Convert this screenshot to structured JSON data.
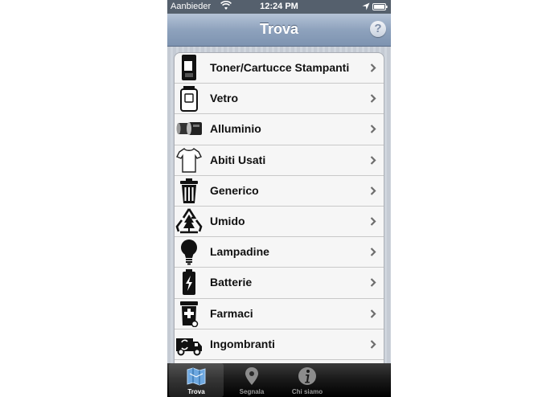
{
  "status_bar": {
    "carrier": "Aanbieder",
    "time": "12:24 PM"
  },
  "nav": {
    "title": "Trova",
    "help_glyph": "?"
  },
  "list": {
    "items": [
      {
        "label": "Toner/Cartucce Stampanti",
        "icon": "printer-cartridge-icon"
      },
      {
        "label": "Vetro",
        "icon": "glass-jar-icon"
      },
      {
        "label": "Alluminio",
        "icon": "aluminium-cans-icon"
      },
      {
        "label": "Abiti Usati",
        "icon": "tshirt-icon"
      },
      {
        "label": "Generico",
        "icon": "trash-bin-icon"
      },
      {
        "label": "Umido",
        "icon": "recycle-tree-icon"
      },
      {
        "label": "Lampadine",
        "icon": "light-bulb-icon"
      },
      {
        "label": "Batterie",
        "icon": "battery-icon"
      },
      {
        "label": "Farmaci",
        "icon": "pharmacy-bin-icon"
      },
      {
        "label": "Ingombranti",
        "icon": "truck-icon"
      }
    ]
  },
  "tabs": [
    {
      "label": "Trova",
      "icon": "map-icon",
      "active": true
    },
    {
      "label": "Segnala",
      "icon": "location-pin-icon",
      "active": false
    },
    {
      "label": "Chi siamo",
      "icon": "info-icon",
      "active": false
    }
  ],
  "colors": {
    "navbar": "#8ea2bd",
    "statusbar": "#55606d",
    "tabbar": "#1b1b1b",
    "active_tab_icon": "#6ea8e0"
  }
}
